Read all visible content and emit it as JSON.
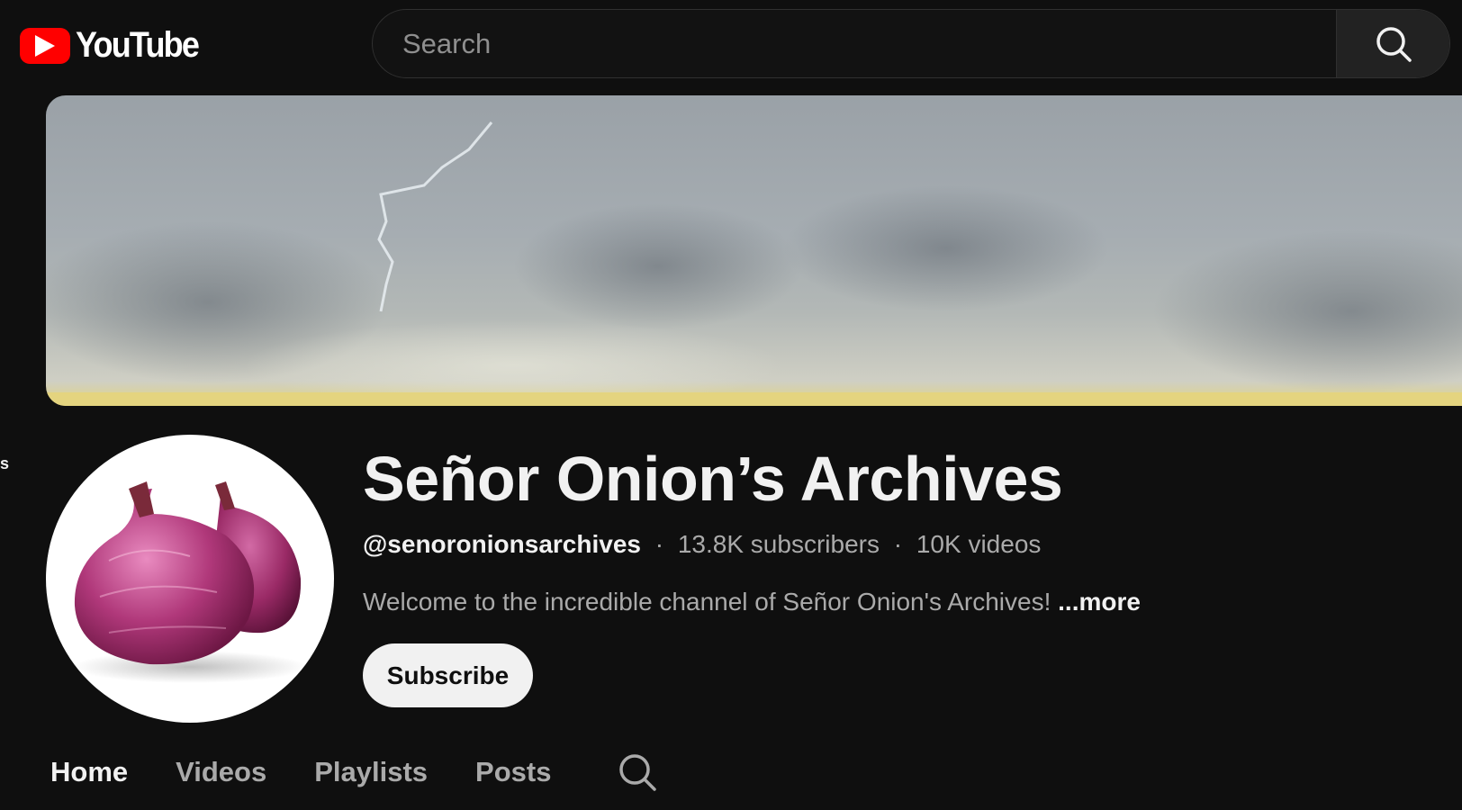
{
  "header": {
    "logo_text": "YouTube",
    "search_placeholder": "Search"
  },
  "sidebar": {
    "edge_letter": "s"
  },
  "channel": {
    "name": "Señor Onion’s Archives",
    "handle": "@senoronionsarchives",
    "subscribers": "13.8K subscribers",
    "videos": "10K videos",
    "separator": "·",
    "description": "Welcome to the incredible channel of Señor Onion's Archives!",
    "more_label": "...more",
    "subscribe_label": "Subscribe"
  },
  "tabs": [
    {
      "label": "Home",
      "active": true
    },
    {
      "label": "Videos",
      "active": false
    },
    {
      "label": "Playlists",
      "active": false
    },
    {
      "label": "Posts",
      "active": false
    }
  ],
  "colors": {
    "background": "#0f0f0f",
    "brand_red": "#ff0000",
    "text_primary": "#f1f1f1",
    "text_secondary": "#aaaaaa",
    "subscribe_bg": "#f1f1f1",
    "onion": "#a3316f"
  },
  "icons": {
    "search": "search-icon",
    "play": "play-icon",
    "tab_search": "search-icon"
  }
}
